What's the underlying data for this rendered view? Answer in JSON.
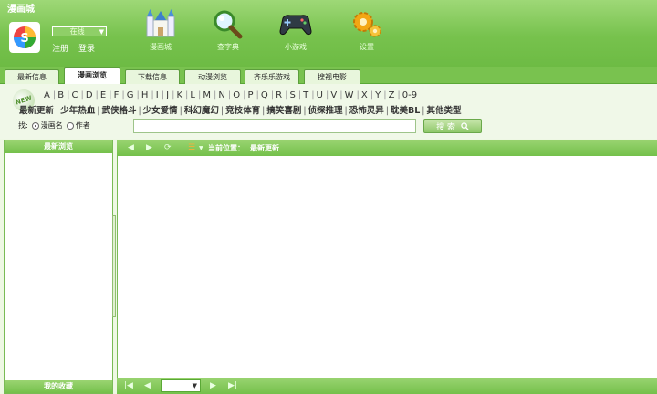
{
  "app": {
    "title": "漫画城"
  },
  "user": {
    "status": "在线",
    "register": "注册",
    "login": "登录"
  },
  "nav": [
    {
      "label": "漫画城",
      "icon": "castle-icon"
    },
    {
      "label": "查字典",
      "icon": "magnifier-icon"
    },
    {
      "label": "小游戏",
      "icon": "gamepad-icon"
    },
    {
      "label": "设置",
      "icon": "gear-icon"
    }
  ],
  "tabs": [
    "最新信息",
    "漫画浏览",
    "下载信息",
    "动漫浏览",
    "齐乐乐游戏",
    "搜视电影"
  ],
  "active_tab": "漫画浏览",
  "filter": {
    "badge": "NEW",
    "letters": [
      "A",
      "B",
      "C",
      "D",
      "E",
      "F",
      "G",
      "H",
      "I",
      "J",
      "K",
      "L",
      "M",
      "N",
      "O",
      "P",
      "Q",
      "R",
      "S",
      "T",
      "U",
      "V",
      "W",
      "X",
      "Y",
      "Z",
      "0-9"
    ],
    "genres": [
      "最新更新",
      "少年热血",
      "武侠格斗",
      "少女爱情",
      "科幻魔幻",
      "竞技体育",
      "搞笑喜剧",
      "侦探推理",
      "恐怖灵异",
      "耽美BL",
      "其他类型"
    ]
  },
  "search": {
    "by_label": "找:",
    "option_title": "漫画名",
    "option_author": "作者",
    "value": "",
    "button": "搜 索"
  },
  "left": {
    "header": "最新浏览",
    "footer": "我的收藏"
  },
  "content": {
    "location_label": "当前位置：",
    "location": "最新更新"
  },
  "pager": {
    "page": ""
  },
  "colors": {
    "accent": "#77c24d",
    "header_top": "#9ed877"
  }
}
